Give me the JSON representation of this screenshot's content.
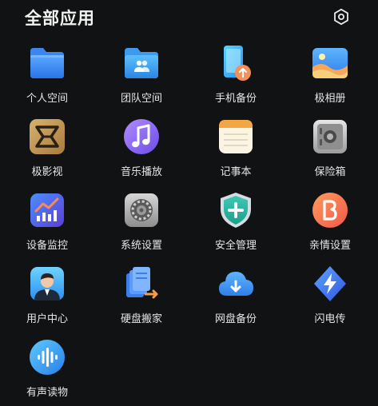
{
  "header": {
    "title": "全部应用",
    "settings_icon": "gear-hexagon-icon"
  },
  "apps": [
    {
      "label": "个人空间",
      "icon": "blue-folder-icon"
    },
    {
      "label": "团队空间",
      "icon": "team-folder-icon"
    },
    {
      "label": "手机备份",
      "icon": "phone-backup-icon"
    },
    {
      "label": "极相册",
      "icon": "photo-album-icon"
    },
    {
      "label": "极影视",
      "icon": "video-app-icon"
    },
    {
      "label": "音乐播放",
      "icon": "music-note-icon"
    },
    {
      "label": "记事本",
      "icon": "notepad-icon"
    },
    {
      "label": "保险箱",
      "icon": "safe-icon"
    },
    {
      "label": "设备监控",
      "icon": "device-monitor-chart-icon"
    },
    {
      "label": "系统设置",
      "icon": "system-settings-gear-icon"
    },
    {
      "label": "安全管理",
      "icon": "shield-plus-icon"
    },
    {
      "label": "亲情设置",
      "icon": "family-app-icon"
    },
    {
      "label": "用户中心",
      "icon": "user-center-avatar-icon"
    },
    {
      "label": "硬盘搬家",
      "icon": "disk-migration-icon"
    },
    {
      "label": "网盘备份",
      "icon": "cloud-upload-icon"
    },
    {
      "label": "闪电传",
      "icon": "lightning-transfer-icon"
    },
    {
      "label": "有声读物",
      "icon": "audiobook-waveform-icon"
    }
  ]
}
